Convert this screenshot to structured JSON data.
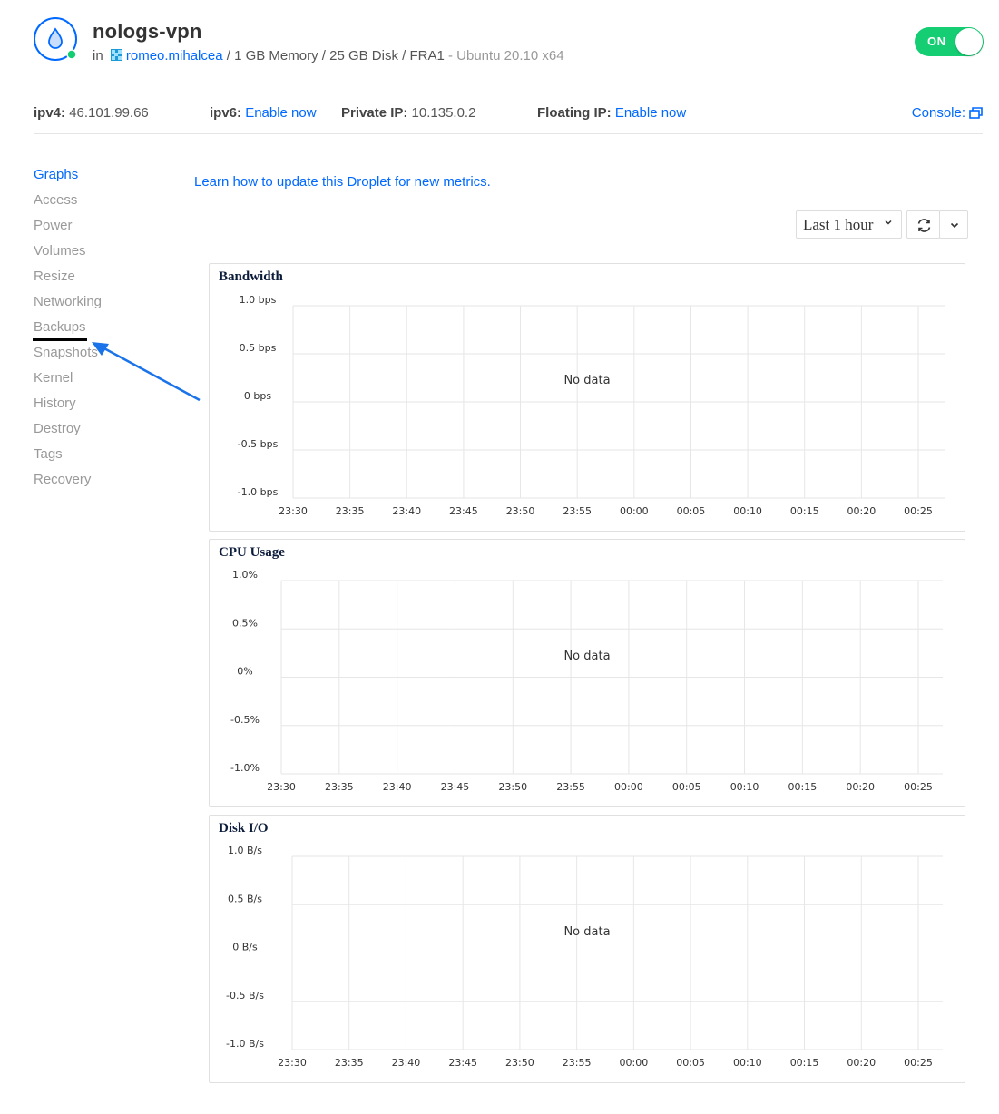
{
  "droplet": {
    "name": "nologs-vpn",
    "in_label": "in",
    "project": "romeo.mihalcea",
    "specs": "/ 1 GB Memory / 25 GB Disk / FRA1",
    "os": "- Ubuntu 20.10 x64",
    "power_label": "ON"
  },
  "network": {
    "ipv4_label": "ipv4:",
    "ipv4": "46.101.99.66",
    "ipv6_label": "ipv6:",
    "ipv6_action": "Enable now",
    "private_label": "Private IP:",
    "private_ip": "10.135.0.2",
    "floating_label": "Floating IP:",
    "floating_action": "Enable now",
    "console_label": "Console:"
  },
  "sidebar": {
    "items": [
      "Graphs",
      "Access",
      "Power",
      "Volumes",
      "Resize",
      "Networking",
      "Backups",
      "Snapshots",
      "Kernel",
      "History",
      "Destroy",
      "Tags",
      "Recovery"
    ],
    "active": "Graphs"
  },
  "metrics_notice": "Learn how to update this Droplet for new metrics.",
  "controls": {
    "time_range": "Last 1 hour"
  },
  "charts": [
    {
      "title": "Bandwidth",
      "y_ticks": [
        "1.0 bps",
        "0.5 bps",
        "0 bps",
        "-0.5 bps",
        "-1.0 bps"
      ],
      "x_ticks": [
        "23:30",
        "23:35",
        "23:40",
        "23:45",
        "23:50",
        "23:55",
        "00:00",
        "00:05",
        "00:10",
        "00:15",
        "00:20",
        "00:25"
      ],
      "empty_text": "No data"
    },
    {
      "title": "CPU Usage",
      "y_ticks": [
        "1.0%",
        "0.5%",
        "0%",
        "-0.5%",
        "-1.0%"
      ],
      "x_ticks": [
        "23:30",
        "23:35",
        "23:40",
        "23:45",
        "23:50",
        "23:55",
        "00:00",
        "00:05",
        "00:10",
        "00:15",
        "00:20",
        "00:25"
      ],
      "empty_text": "No data"
    },
    {
      "title": "Disk I/O",
      "y_ticks": [
        "1.0 B/s",
        "0.5 B/s",
        "0 B/s",
        "-0.5 B/s",
        "-1.0 B/s"
      ],
      "x_ticks": [
        "23:30",
        "23:35",
        "23:40",
        "23:45",
        "23:50",
        "23:55",
        "00:00",
        "00:05",
        "00:10",
        "00:15",
        "00:20",
        "00:25"
      ],
      "empty_text": "No data"
    }
  ],
  "colors": {
    "accent": "#0069ff",
    "on": "#15cd72",
    "muted": "#999999",
    "arrow": "#1a73e8"
  }
}
